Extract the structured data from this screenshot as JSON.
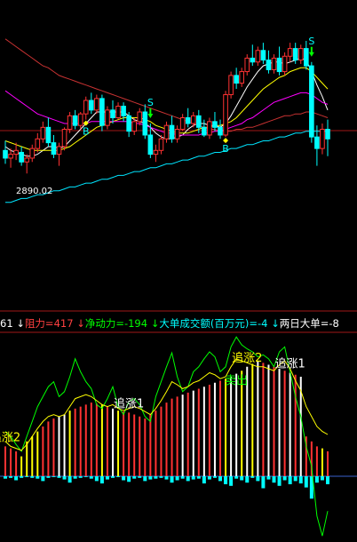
{
  "colors": {
    "background": "#000000",
    "up": "#ff3232",
    "down": "#00ffff",
    "ma_white": "#ffffff",
    "ma_yellow": "#ffff00",
    "ma_magenta": "#ff00ff",
    "ma_red": "#c83232",
    "ma_cyan": "#00e5ff",
    "green_line": "#00ff00",
    "grid": "#a01818"
  },
  "indicator_bar": [
    {
      "text": "61 ↓ ",
      "color": "#ffffff"
    },
    {
      "text": "阻力=417 ↓ ",
      "color": "#ff4040"
    },
    {
      "text": "净动力=-194 ↓ ",
      "color": "#00ff00"
    },
    {
      "text": "大单成交额(百万元)=-4 ↓ ",
      "color": "#00ffff"
    },
    {
      "text": "两日大单=-8",
      "color": "#ffffff"
    }
  ],
  "chart_data": [
    {
      "type": "candlestick",
      "title": "",
      "price_label": "2890.02",
      "signal_labels": {
        "buy": "B",
        "sell": "S"
      },
      "ohlc": [
        [
          2901,
          2906,
          2894,
          2897
        ],
        [
          2897,
          2902,
          2892,
          2899
        ],
        [
          2899,
          2905,
          2896,
          2901
        ],
        [
          2900,
          2903,
          2893,
          2895
        ],
        [
          2895,
          2899,
          2889,
          2897
        ],
        [
          2897,
          2904,
          2895,
          2902
        ],
        [
          2902,
          2910,
          2900,
          2907
        ],
        [
          2907,
          2916,
          2905,
          2913
        ],
        [
          2913,
          2918,
          2903,
          2905
        ],
        [
          2905,
          2909,
          2897,
          2899
        ],
        [
          2899,
          2905,
          2893,
          2903
        ],
        [
          2903,
          2913,
          2901,
          2912
        ],
        [
          2912,
          2921,
          2910,
          2919
        ],
        [
          2919,
          2922,
          2912,
          2914
        ],
        [
          2914,
          2921,
          2912,
          2920
        ],
        [
          2920,
          2929,
          2917,
          2927
        ],
        [
          2927,
          2931,
          2920,
          2922
        ],
        [
          2922,
          2930,
          2920,
          2928
        ],
        [
          2928,
          2930,
          2911,
          2914
        ],
        [
          2914,
          2924,
          2912,
          2922
        ],
        [
          2922,
          2927,
          2915,
          2918
        ],
        [
          2918,
          2926,
          2917,
          2924
        ],
        [
          2924,
          2926,
          2916,
          2919
        ],
        [
          2919,
          2921,
          2908,
          2911
        ],
        [
          2911,
          2918,
          2909,
          2916
        ],
        [
          2916,
          2923,
          2914,
          2921
        ],
        [
          2921,
          2925,
          2907,
          2909
        ],
        [
          2909,
          2915,
          2897,
          2899
        ],
        [
          2899,
          2904,
          2895,
          2901
        ],
        [
          2901,
          2909,
          2899,
          2907
        ],
        [
          2907,
          2916,
          2905,
          2914
        ],
        [
          2914,
          2919,
          2905,
          2907
        ],
        [
          2907,
          2914,
          2905,
          2912
        ],
        [
          2912,
          2920,
          2911,
          2918
        ],
        [
          2918,
          2923,
          2913,
          2915
        ],
        [
          2915,
          2921,
          2913,
          2919
        ],
        [
          2919,
          2922,
          2910,
          2913
        ],
        [
          2913,
          2917,
          2908,
          2909
        ],
        [
          2909,
          2918,
          2907,
          2916
        ],
        [
          2916,
          2921,
          2911,
          2913
        ],
        [
          2913,
          2917,
          2907,
          2909
        ],
        [
          2909,
          2932,
          2908,
          2930
        ],
        [
          2930,
          2942,
          2928,
          2940
        ],
        [
          2940,
          2944,
          2933,
          2936
        ],
        [
          2936,
          2944,
          2934,
          2942
        ],
        [
          2942,
          2951,
          2940,
          2949
        ],
        [
          2949,
          2956,
          2945,
          2947
        ],
        [
          2947,
          2955,
          2945,
          2953
        ],
        [
          2953,
          2957,
          2946,
          2948
        ],
        [
          2948,
          2953,
          2941,
          2943
        ],
        [
          2943,
          2951,
          2941,
          2949
        ],
        [
          2949,
          2955,
          2940,
          2942
        ],
        [
          2942,
          2952,
          2940,
          2950
        ],
        [
          2950,
          2957,
          2947,
          2954
        ],
        [
          2954,
          2957,
          2946,
          2948
        ],
        [
          2948,
          2956,
          2946,
          2954
        ],
        [
          2954,
          2958,
          2943,
          2945
        ],
        [
          2945,
          2947,
          2905,
          2908
        ],
        [
          2908,
          2914,
          2893,
          2902
        ],
        [
          2902,
          2915,
          2899,
          2912
        ],
        [
          2912,
          2917,
          2898,
          2907
        ]
      ],
      "ma": [
        {
          "name": "",
          "color": "#ffffff",
          "values": [
            2903,
            2901,
            2900,
            2899,
            2898,
            2898,
            2899,
            2901,
            2903,
            2903,
            2902,
            2903,
            2906,
            2909,
            2912,
            2915,
            2918,
            2921,
            2921,
            2921,
            2921,
            2921,
            2921,
            2919,
            2917,
            2916,
            2915,
            2913,
            2910,
            2908,
            2907,
            2907,
            2908,
            2909,
            2912,
            2914,
            2915,
            2915,
            2914,
            2914,
            2913,
            2915,
            2919,
            2924,
            2929,
            2934,
            2938,
            2942,
            2945,
            2946,
            2947,
            2947,
            2946,
            2947,
            2948,
            2949,
            2948,
            2942,
            2935,
            2929,
            2922
          ]
        },
        {
          "name": "",
          "color": "#ffff00",
          "values": [
            2906,
            2905,
            2904,
            2903,
            2902,
            2901,
            2901,
            2901,
            2901,
            2901,
            2901,
            2902,
            2903,
            2905,
            2907,
            2909,
            2911,
            2913,
            2914,
            2915,
            2916,
            2917,
            2918,
            2918,
            2918,
            2918,
            2917,
            2916,
            2914,
            2913,
            2912,
            2911,
            2910,
            2910,
            2910,
            2911,
            2912,
            2913,
            2913,
            2914,
            2914,
            2915,
            2916,
            2918,
            2921,
            2924,
            2927,
            2930,
            2933,
            2935,
            2937,
            2939,
            2940,
            2942,
            2943,
            2944,
            2944,
            2942,
            2939,
            2936,
            2933
          ]
        },
        {
          "name": "",
          "color": "#ff00ff",
          "values": [
            2932,
            2930,
            2928,
            2926,
            2924,
            2922,
            2920,
            2919,
            2918,
            2917,
            2916,
            2915,
            2915,
            2915,
            2915,
            2915,
            2916,
            2916,
            2916,
            2916,
            2916,
            2916,
            2916,
            2916,
            2915,
            2915,
            2914,
            2913,
            2912,
            2911,
            2910,
            2910,
            2909,
            2909,
            2909,
            2909,
            2909,
            2910,
            2910,
            2911,
            2911,
            2912,
            2913,
            2914,
            2915,
            2917,
            2918,
            2920,
            2922,
            2924,
            2926,
            2927,
            2928,
            2929,
            2930,
            2931,
            2931,
            2930,
            2928,
            2926,
            2925
          ]
        },
        {
          "name": "",
          "color": "#c83232",
          "values": [
            2959,
            2957,
            2955,
            2953,
            2951,
            2949,
            2947,
            2945,
            2944,
            2942,
            2940,
            2939,
            2938,
            2937,
            2936,
            2935,
            2934,
            2933,
            2932,
            2931,
            2930,
            2929,
            2928,
            2927,
            2926,
            2925,
            2924,
            2923,
            2922,
            2921,
            2920,
            2919,
            2918,
            2917,
            2916,
            2915,
            2914,
            2913,
            2912,
            2912,
            2911,
            2911,
            2911,
            2912,
            2912,
            2913,
            2913,
            2914,
            2915,
            2916,
            2917,
            2918,
            2919,
            2919,
            2920,
            2920,
            2921,
            2921,
            2920,
            2919,
            2918
          ]
        },
        {
          "name": "",
          "color": "#00e5ff",
          "values": [
            2874,
            2874,
            2875,
            2876,
            2876,
            2877,
            2878,
            2878,
            2879,
            2880,
            2880,
            2881,
            2882,
            2882,
            2883,
            2884,
            2884,
            2885,
            2886,
            2886,
            2887,
            2888,
            2888,
            2889,
            2890,
            2890,
            2891,
            2892,
            2892,
            2893,
            2894,
            2894,
            2895,
            2896,
            2896,
            2897,
            2898,
            2898,
            2899,
            2900,
            2900,
            2901,
            2902,
            2902,
            2903,
            2904,
            2904,
            2905,
            2906,
            2906,
            2907,
            2908,
            2908,
            2909,
            2910,
            2910,
            2911,
            2911,
            2911,
            2911,
            2911
          ]
        }
      ],
      "buy_signals": [
        15,
        41
      ],
      "sell_signals": [
        27,
        57
      ]
    },
    {
      "type": "bar",
      "title": "",
      "bars": [
        30,
        28,
        25,
        20,
        35,
        40,
        45,
        50,
        55,
        58,
        60,
        62,
        66,
        68,
        70,
        72,
        74,
        73,
        72,
        70,
        68,
        66,
        65,
        64,
        62,
        60,
        58,
        62,
        66,
        70,
        74,
        78,
        80,
        82,
        84,
        86,
        88,
        90,
        92,
        94,
        96,
        98,
        100,
        103,
        106,
        110,
        113,
        116,
        114,
        112,
        110,
        108,
        106,
        104,
        102,
        100,
        40,
        35,
        30,
        28,
        25
      ],
      "bar_colors": [
        "r",
        "r",
        "r",
        "y",
        "y",
        "y",
        "y",
        "r",
        "r",
        "r",
        "w",
        "w",
        "y",
        "r",
        "r",
        "r",
        "r",
        "r",
        "y",
        "r",
        "w",
        "y",
        "r",
        "r",
        "r",
        "r",
        "r",
        "r",
        "r",
        "r",
        "r",
        "r",
        "r",
        "w",
        "r",
        "w",
        "r",
        "w",
        "r",
        "w",
        "r",
        "y",
        "w",
        "w",
        "y",
        "w",
        "y",
        "w",
        "r",
        "w",
        "r",
        "w",
        "r",
        "w",
        "r",
        "w",
        "r",
        "r",
        "r",
        "y",
        "r"
      ],
      "flow": [
        -3,
        -2,
        -5,
        -2,
        -1,
        -2,
        -3,
        -6,
        -2,
        -1,
        -2,
        -4,
        -8,
        -3,
        -2,
        -1,
        -3,
        -6,
        -9,
        -4,
        -2,
        -1,
        -5,
        -7,
        -3,
        -2,
        -6,
        -4,
        -3,
        -2,
        -4,
        -8,
        -5,
        -3,
        -6,
        -4,
        -3,
        -9,
        -4,
        -2,
        -6,
        -10,
        -12,
        -3,
        -5,
        -8,
        -2,
        -6,
        -15,
        -4,
        -8,
        -12,
        -5,
        -10,
        -6,
        -9,
        -14,
        -28,
        -8,
        -5,
        -10
      ],
      "green_line": [
        45,
        40,
        32,
        25,
        40,
        55,
        70,
        80,
        90,
        95,
        80,
        85,
        100,
        118,
        105,
        95,
        88,
        72,
        68,
        78,
        90,
        70,
        62,
        75,
        78,
        72,
        60,
        55,
        80,
        95,
        110,
        124,
        100,
        85,
        90,
        105,
        110,
        118,
        125,
        120,
        105,
        110,
        130,
        140,
        132,
        128,
        125,
        120,
        122,
        118,
        110,
        125,
        130,
        105,
        80,
        60,
        30,
        10,
        -40,
        -60,
        -35
      ],
      "yellow_line": [
        35,
        30,
        28,
        26,
        32,
        40,
        48,
        55,
        60,
        62,
        60,
        62,
        70,
        78,
        80,
        82,
        80,
        76,
        72,
        70,
        72,
        68,
        66,
        68,
        70,
        68,
        65,
        62,
        68,
        76,
        85,
        95,
        92,
        88,
        90,
        94,
        96,
        100,
        104,
        102,
        98,
        100,
        110,
        118,
        116,
        114,
        112,
        110,
        110,
        108,
        106,
        112,
        116,
        108,
        96,
        86,
        70,
        60,
        50,
        45,
        42
      ],
      "signal_labels": {
        "chase": "追涨1",
        "chase2": "追涨2",
        "sell": "卖出"
      },
      "chase_positions": [
        23,
        53
      ],
      "chase2_positions": [
        0,
        45
      ],
      "sell_positions": [
        43
      ]
    }
  ]
}
